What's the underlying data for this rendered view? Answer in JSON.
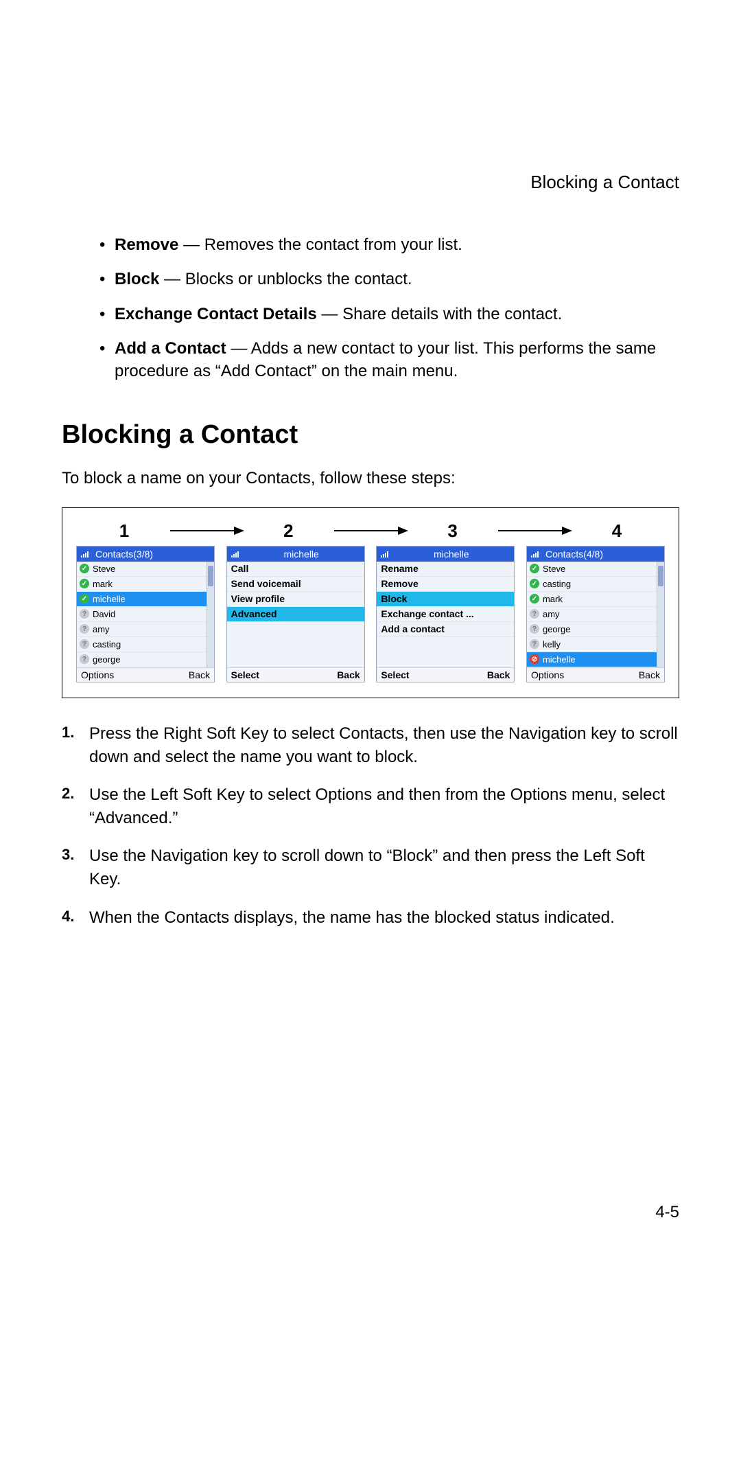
{
  "running_header": "Blocking a Contact",
  "bullets": [
    {
      "term": "Remove",
      "desc": " — Removes the contact from your list."
    },
    {
      "term": "Block",
      "desc": " — Blocks or unblocks the contact."
    },
    {
      "term": "Exchange Contact Details",
      "desc": " — Share details with the contact."
    },
    {
      "term": "Add a Contact",
      "desc": " — Adds a new contact to your list. This performs the same procedure as “Add Contact” on the main menu."
    }
  ],
  "section_heading": "Blocking a Contact",
  "intro": "To block a name on your Contacts, follow these steps:",
  "figure": {
    "nums": [
      "1",
      "2",
      "3",
      "4"
    ],
    "screens": [
      {
        "title": "Contacts(3/8)",
        "title_align": "left",
        "type": "contacts",
        "rows": [
          {
            "name": "Steve",
            "status": "on",
            "sel": false
          },
          {
            "name": "mark",
            "status": "on",
            "sel": false
          },
          {
            "name": "michelle",
            "status": "on",
            "sel": true
          },
          {
            "name": "David",
            "status": "off",
            "sel": false
          },
          {
            "name": "amy",
            "status": "off",
            "sel": false
          },
          {
            "name": "casting",
            "status": "off",
            "sel": false
          },
          {
            "name": "george",
            "status": "off",
            "sel": false
          }
        ],
        "soft": {
          "left": "Options",
          "right": "Back",
          "bold": false
        },
        "scroll": true
      },
      {
        "title": "michelle",
        "title_align": "center",
        "type": "menu",
        "rows": [
          {
            "label": "Call",
            "sel": false
          },
          {
            "label": "Send voicemail",
            "sel": false
          },
          {
            "label": "View profile",
            "sel": false
          },
          {
            "label": "Advanced",
            "sel": true
          }
        ],
        "soft": {
          "left": "Select",
          "right": "Back",
          "bold": true
        },
        "scroll": false
      },
      {
        "title": "michelle",
        "title_align": "center",
        "type": "menu",
        "rows": [
          {
            "label": "Rename",
            "sel": false
          },
          {
            "label": "Remove",
            "sel": false
          },
          {
            "label": "Block",
            "sel": true
          },
          {
            "label": "Exchange contact ...",
            "sel": false
          },
          {
            "label": "Add a contact",
            "sel": false
          }
        ],
        "soft": {
          "left": "Select",
          "right": "Back",
          "bold": true
        },
        "scroll": false
      },
      {
        "title": "Contacts(4/8)",
        "title_align": "left",
        "type": "contacts",
        "rows": [
          {
            "name": "Steve",
            "status": "on",
            "sel": false
          },
          {
            "name": "casting",
            "status": "on",
            "sel": false
          },
          {
            "name": "mark",
            "status": "on",
            "sel": false
          },
          {
            "name": "amy",
            "status": "off",
            "sel": false
          },
          {
            "name": "george",
            "status": "off",
            "sel": false
          },
          {
            "name": "kelly",
            "status": "off",
            "sel": false
          },
          {
            "name": "michelle",
            "status": "blocked",
            "sel": true
          }
        ],
        "soft": {
          "left": "Options",
          "right": "Back",
          "bold": false
        },
        "scroll": true
      }
    ]
  },
  "steps": [
    "Press the Right Soft Key to select Contacts, then use the Navigation key to scroll down and select the name you want to block.",
    "Use the Left Soft Key to select Options and then from the Options menu, select “Advanced.”",
    "Use the Navigation key to scroll down to “Block” and then press the Left Soft Key.",
    "When the Contacts displays, the name has the blocked status indicated."
  ],
  "page_number": "4-5",
  "step_nums": [
    "1.",
    "2.",
    "3.",
    "4."
  ],
  "icon_glyphs": {
    "on": "✓",
    "off": "?",
    "blocked": "⊘"
  }
}
